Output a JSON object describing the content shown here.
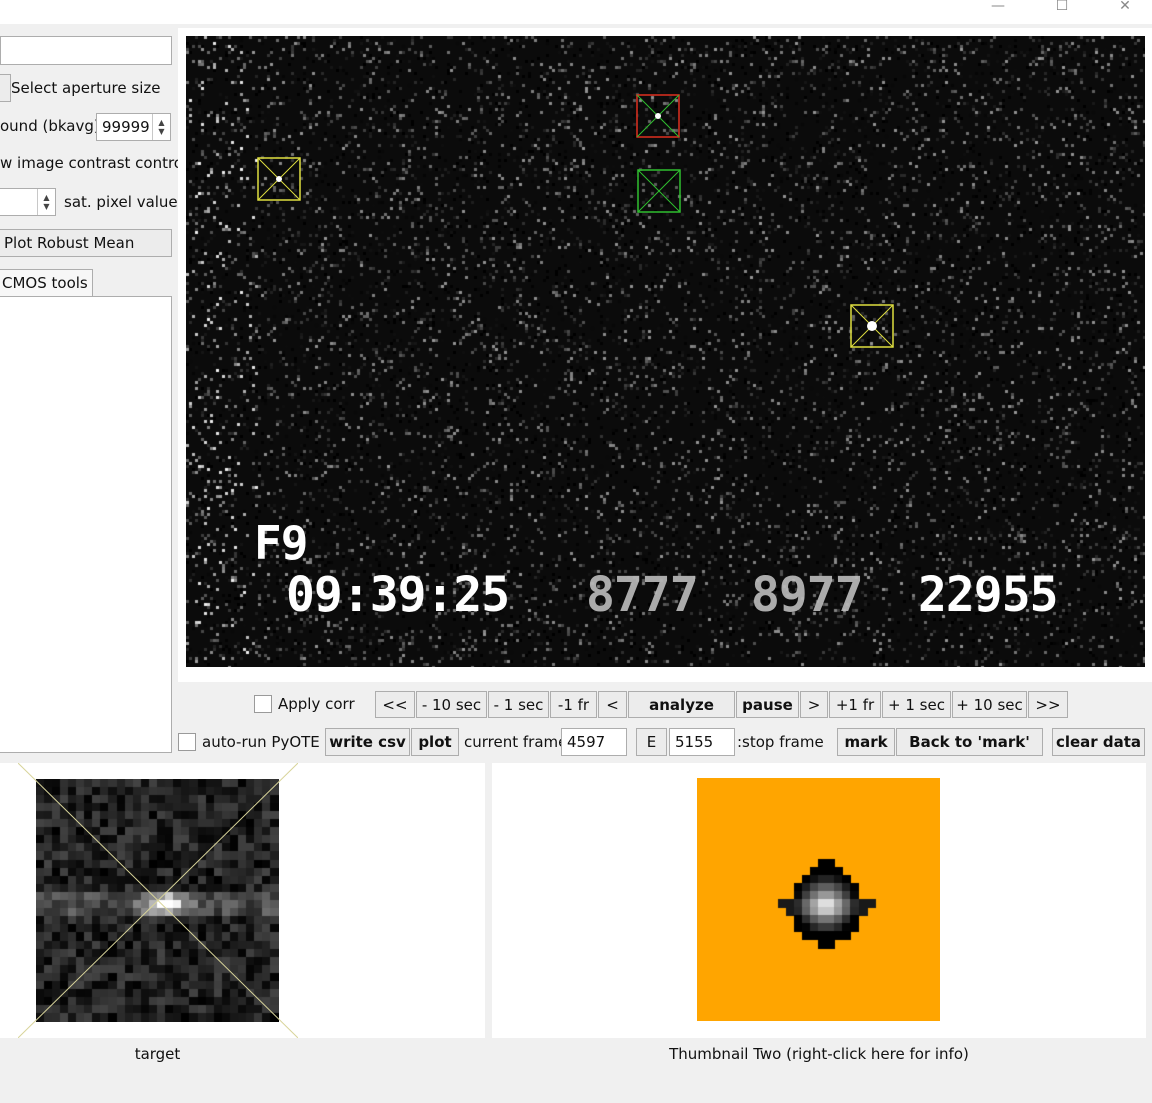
{
  "window": {
    "minimize_glyph": "—",
    "maximize_glyph": "☐",
    "close_glyph": "✕"
  },
  "left_panel": {
    "aperture_button": "Select aperture size",
    "background_label": "ound (bkavg)",
    "background_value": "99999",
    "contrast_label": "w image contrast control",
    "sat_pixel_label": "sat. pixel value",
    "robust_mean_button": "Plot Robust Mean",
    "cmos_tab": "CMOS tools"
  },
  "video": {
    "frame_label": "F9",
    "timestamp": "09:39:25",
    "field2": "8777",
    "field3": "8977",
    "field4": "22955",
    "apertures": [
      {
        "name": "yellow-aperture-left",
        "color": "#e0e040"
      },
      {
        "name": "red-aperture",
        "color": "#e03020"
      },
      {
        "name": "green-aperture",
        "color": "#30c030"
      },
      {
        "name": "yellow-aperture-right",
        "color": "#e0e040"
      }
    ]
  },
  "controls": {
    "apply_corr": "Apply corr",
    "nav": {
      "first": "<<",
      "back10": "- 10 sec",
      "back1": "- 1 sec",
      "back_fr": "-1 fr",
      "prev": "<",
      "analyze": "analyze",
      "pause": "pause",
      "next": ">",
      "fwd_fr": "+1 fr",
      "fwd1": "+ 1 sec",
      "fwd10": "+ 10 sec",
      "last": ">>"
    },
    "autorun": "auto-run PyOTE",
    "write_csv": "write csv",
    "plot": "plot",
    "current_frame_label": "current frame:",
    "current_frame_value": "4597",
    "e_button": "E",
    "stop_frame_value": "5155",
    "stop_frame_label": ":stop frame",
    "mark": "mark",
    "back_to_mark": "Back to 'mark'",
    "clear_data": "clear data"
  },
  "thumbnails": {
    "one_caption": "target",
    "two_caption": "Thumbnail Two (right-click here for info)",
    "two_background": "#ffa500"
  }
}
